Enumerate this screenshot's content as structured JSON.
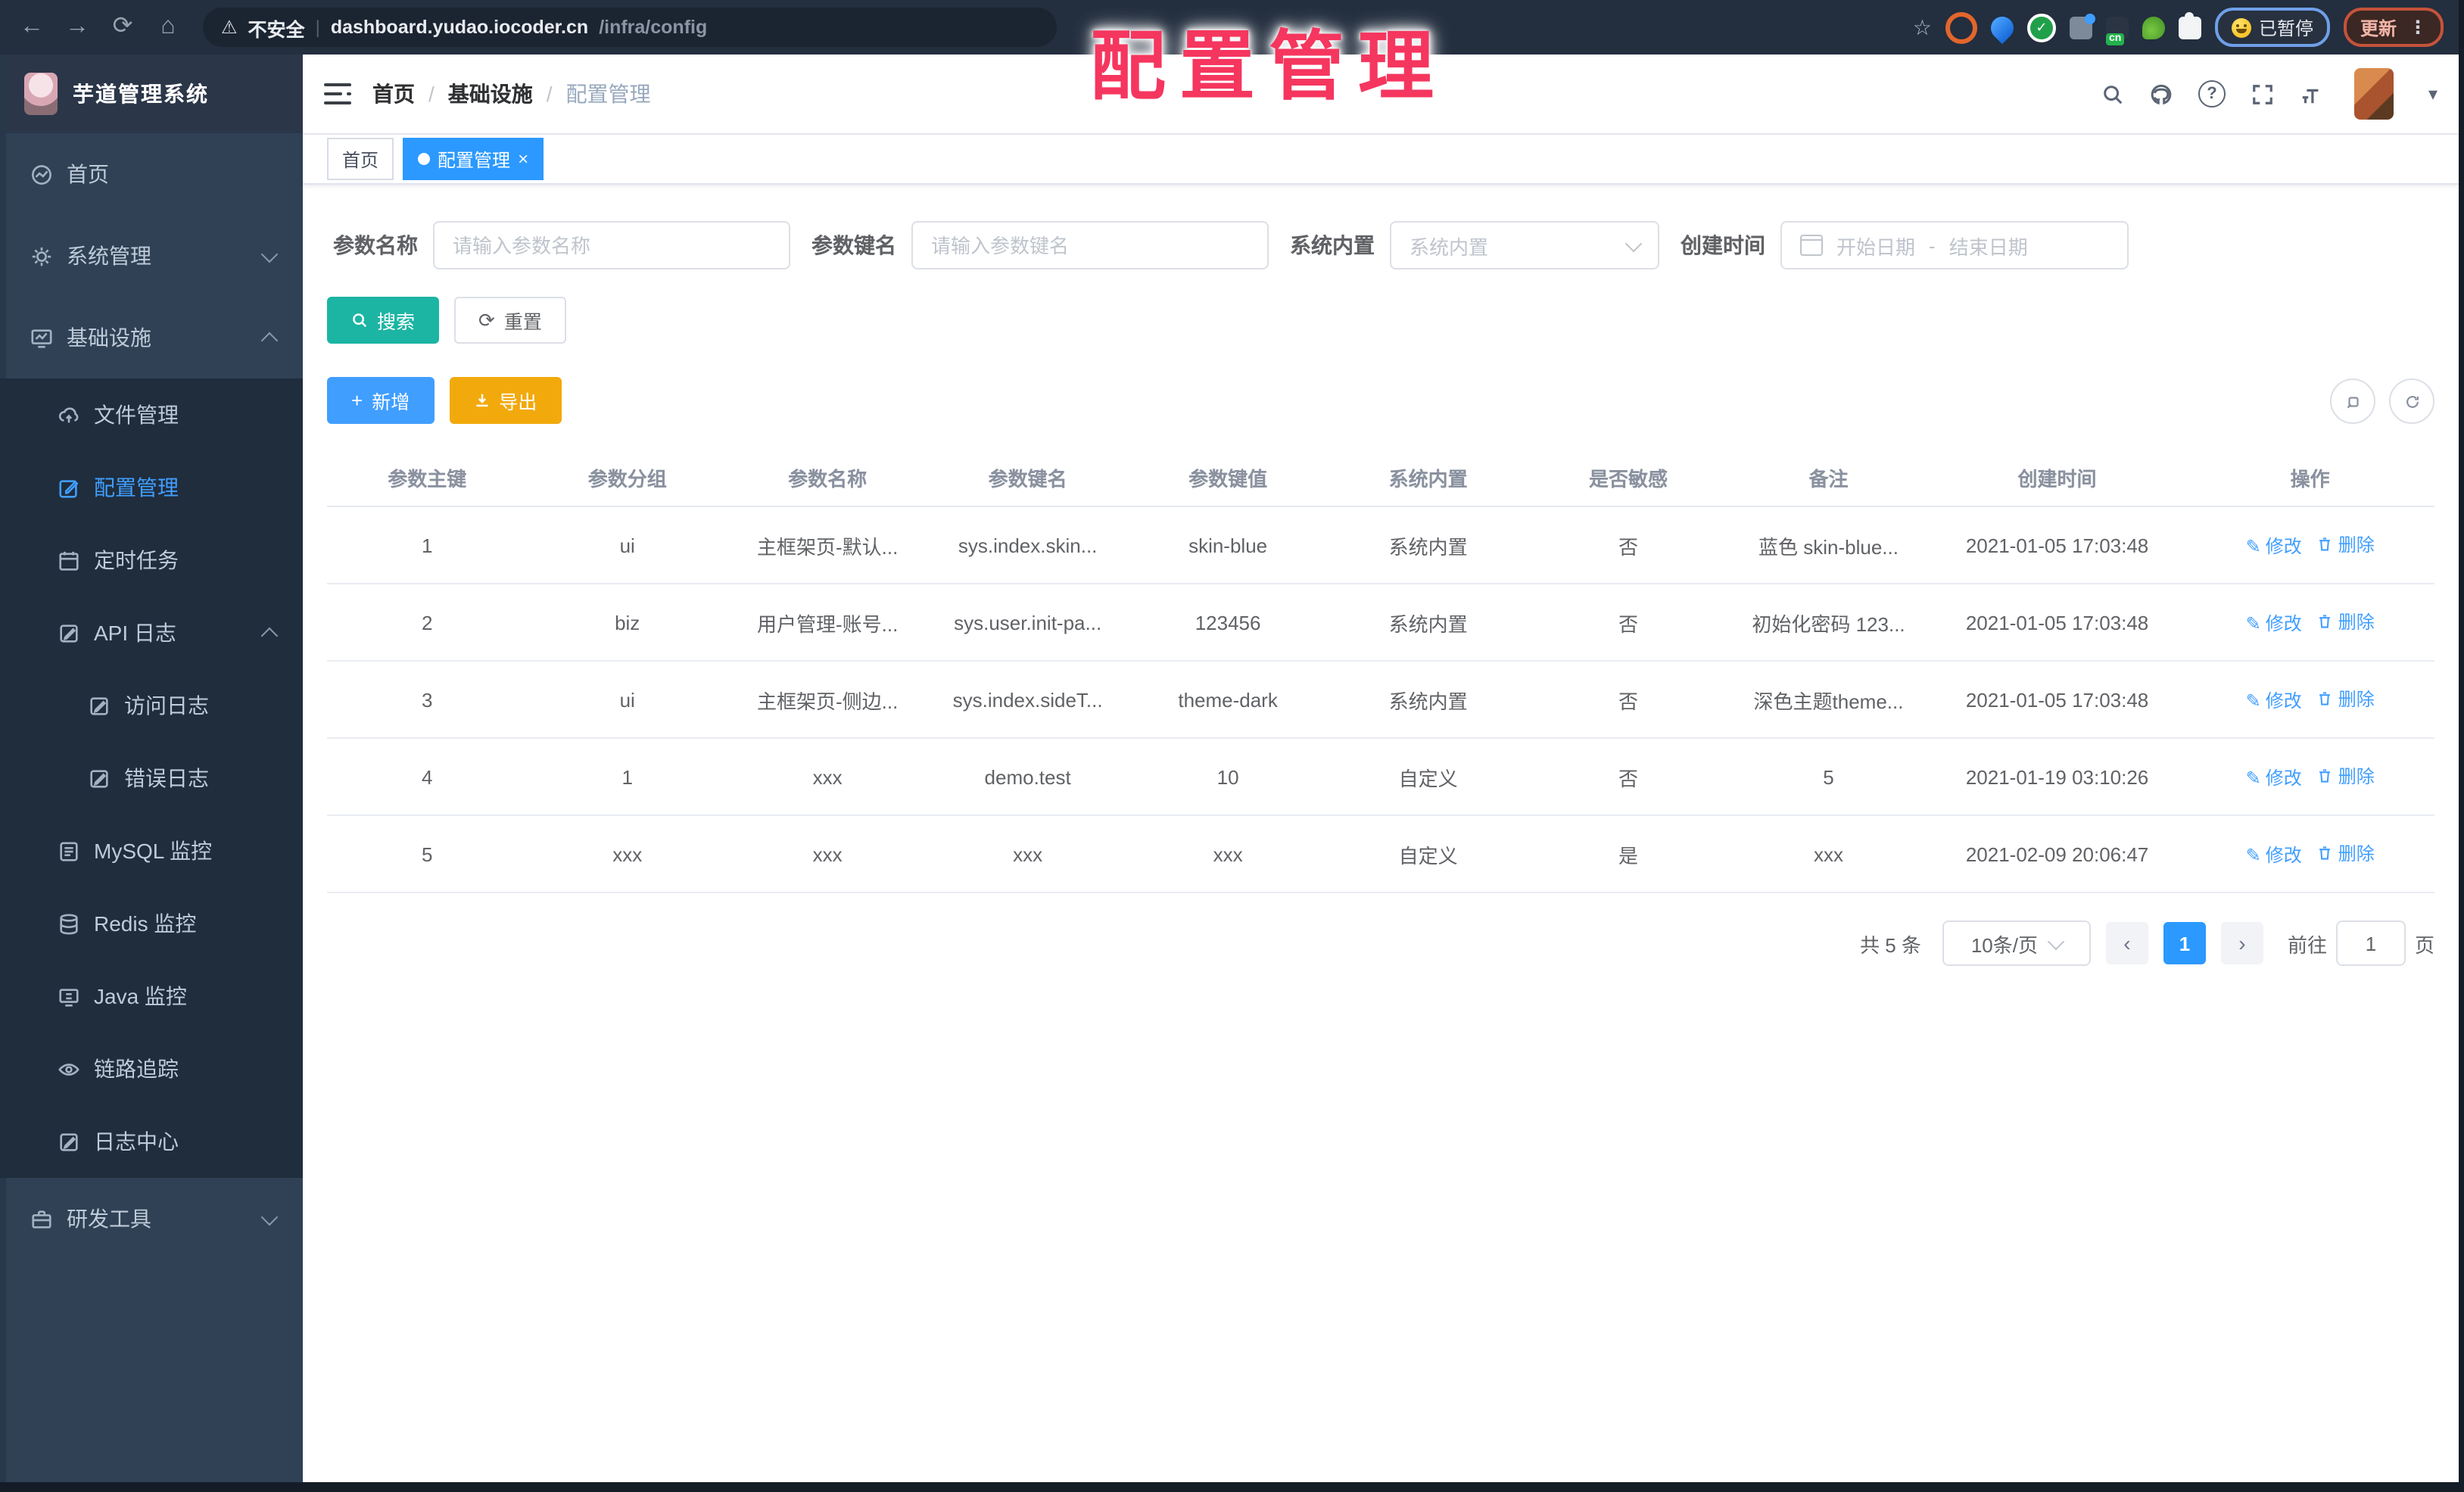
{
  "colors": {
    "accent": "#409eff",
    "active_tab": "#2b99ff",
    "search_teal": "#1cb5a3",
    "export_yellow": "#f2a90c",
    "overlay_red": "#f5365f",
    "sidebar_bg": "#304156",
    "submenu_bg": "#1f2d3d"
  },
  "icons": {
    "back": "←",
    "forward": "→",
    "reload": "⟳",
    "home": "⌂",
    "warning": "⚠",
    "star": "☆",
    "dots_vertical": "⋮",
    "close": "×",
    "caret_down": "▾",
    "question_mark": "?",
    "plus": "+",
    "chevron_left": "‹",
    "chevron_right": "›",
    "edit_pencil": "✎"
  },
  "browser": {
    "security_label": "不安全",
    "url_host": "dashboard.yudao.iocoder.cn",
    "url_path": "/infra/config",
    "paused_badge": "已暂停",
    "update_button": "更新",
    "cn_badge": "cn"
  },
  "overlay_title": "配置管理",
  "app": {
    "logo_title": "芋道管理系统"
  },
  "sidebar": {
    "items": [
      {
        "label": "首页"
      },
      {
        "label": "系统管理"
      },
      {
        "label": "基础设施"
      },
      {
        "label": "文件管理"
      },
      {
        "label": "配置管理"
      },
      {
        "label": "定时任务"
      },
      {
        "label": "API 日志"
      },
      {
        "label": "访问日志"
      },
      {
        "label": "错误日志"
      },
      {
        "label": "MySQL 监控"
      },
      {
        "label": "Redis 监控"
      },
      {
        "label": "Java 监控"
      },
      {
        "label": "链路追踪"
      },
      {
        "label": "日志中心"
      },
      {
        "label": "研发工具"
      }
    ]
  },
  "breadcrumb": {
    "items": [
      "首页",
      "基础设施",
      "配置管理"
    ],
    "separator": "/"
  },
  "tabs": [
    {
      "label": "首页"
    },
    {
      "label": "配置管理"
    }
  ],
  "search_form": {
    "name_label": "参数名称",
    "name_placeholder": "请输入参数名称",
    "key_label": "参数键名",
    "key_placeholder": "请输入参数键名",
    "builtin_label": "系统内置",
    "builtin_placeholder": "系统内置",
    "date_label": "创建时间",
    "date_start_placeholder": "开始日期",
    "date_separator": "-",
    "date_end_placeholder": "结束日期",
    "search_button": "搜索",
    "reset_button": "重置"
  },
  "toolbar": {
    "add_button": "新增",
    "export_button": "导出"
  },
  "table": {
    "columns": [
      "参数主键",
      "参数分组",
      "参数名称",
      "参数键名",
      "参数键值",
      "系统内置",
      "是否敏感",
      "备注",
      "创建时间",
      "操作"
    ],
    "action_edit": "修改",
    "action_delete": "删除",
    "rows": [
      {
        "id": "1",
        "group": "ui",
        "name": "主框架页-默认...",
        "key": "sys.index.skin...",
        "value": "skin-blue",
        "builtin": "系统内置",
        "sensitive": "否",
        "remark": "蓝色 skin-blue...",
        "created": "2021-01-05 17:03:48"
      },
      {
        "id": "2",
        "group": "biz",
        "name": "用户管理-账号...",
        "key": "sys.user.init-pa...",
        "value": "123456",
        "builtin": "系统内置",
        "sensitive": "否",
        "remark": "初始化密码 123...",
        "created": "2021-01-05 17:03:48"
      },
      {
        "id": "3",
        "group": "ui",
        "name": "主框架页-侧边...",
        "key": "sys.index.sideT...",
        "value": "theme-dark",
        "builtin": "系统内置",
        "sensitive": "否",
        "remark": "深色主题theme...",
        "created": "2021-01-05 17:03:48"
      },
      {
        "id": "4",
        "group": "1",
        "name": "xxx",
        "key": "demo.test",
        "value": "10",
        "builtin": "自定义",
        "sensitive": "否",
        "remark": "5",
        "created": "2021-01-19 03:10:26"
      },
      {
        "id": "5",
        "group": "xxx",
        "name": "xxx",
        "key": "xxx",
        "value": "xxx",
        "builtin": "自定义",
        "sensitive": "是",
        "remark": "xxx",
        "created": "2021-02-09 20:06:47"
      }
    ]
  },
  "pagination": {
    "total": "共 5 条",
    "page_size": "10条/页",
    "current": "1",
    "goto": "前往",
    "page_unit": "页",
    "goto_value": "1"
  }
}
